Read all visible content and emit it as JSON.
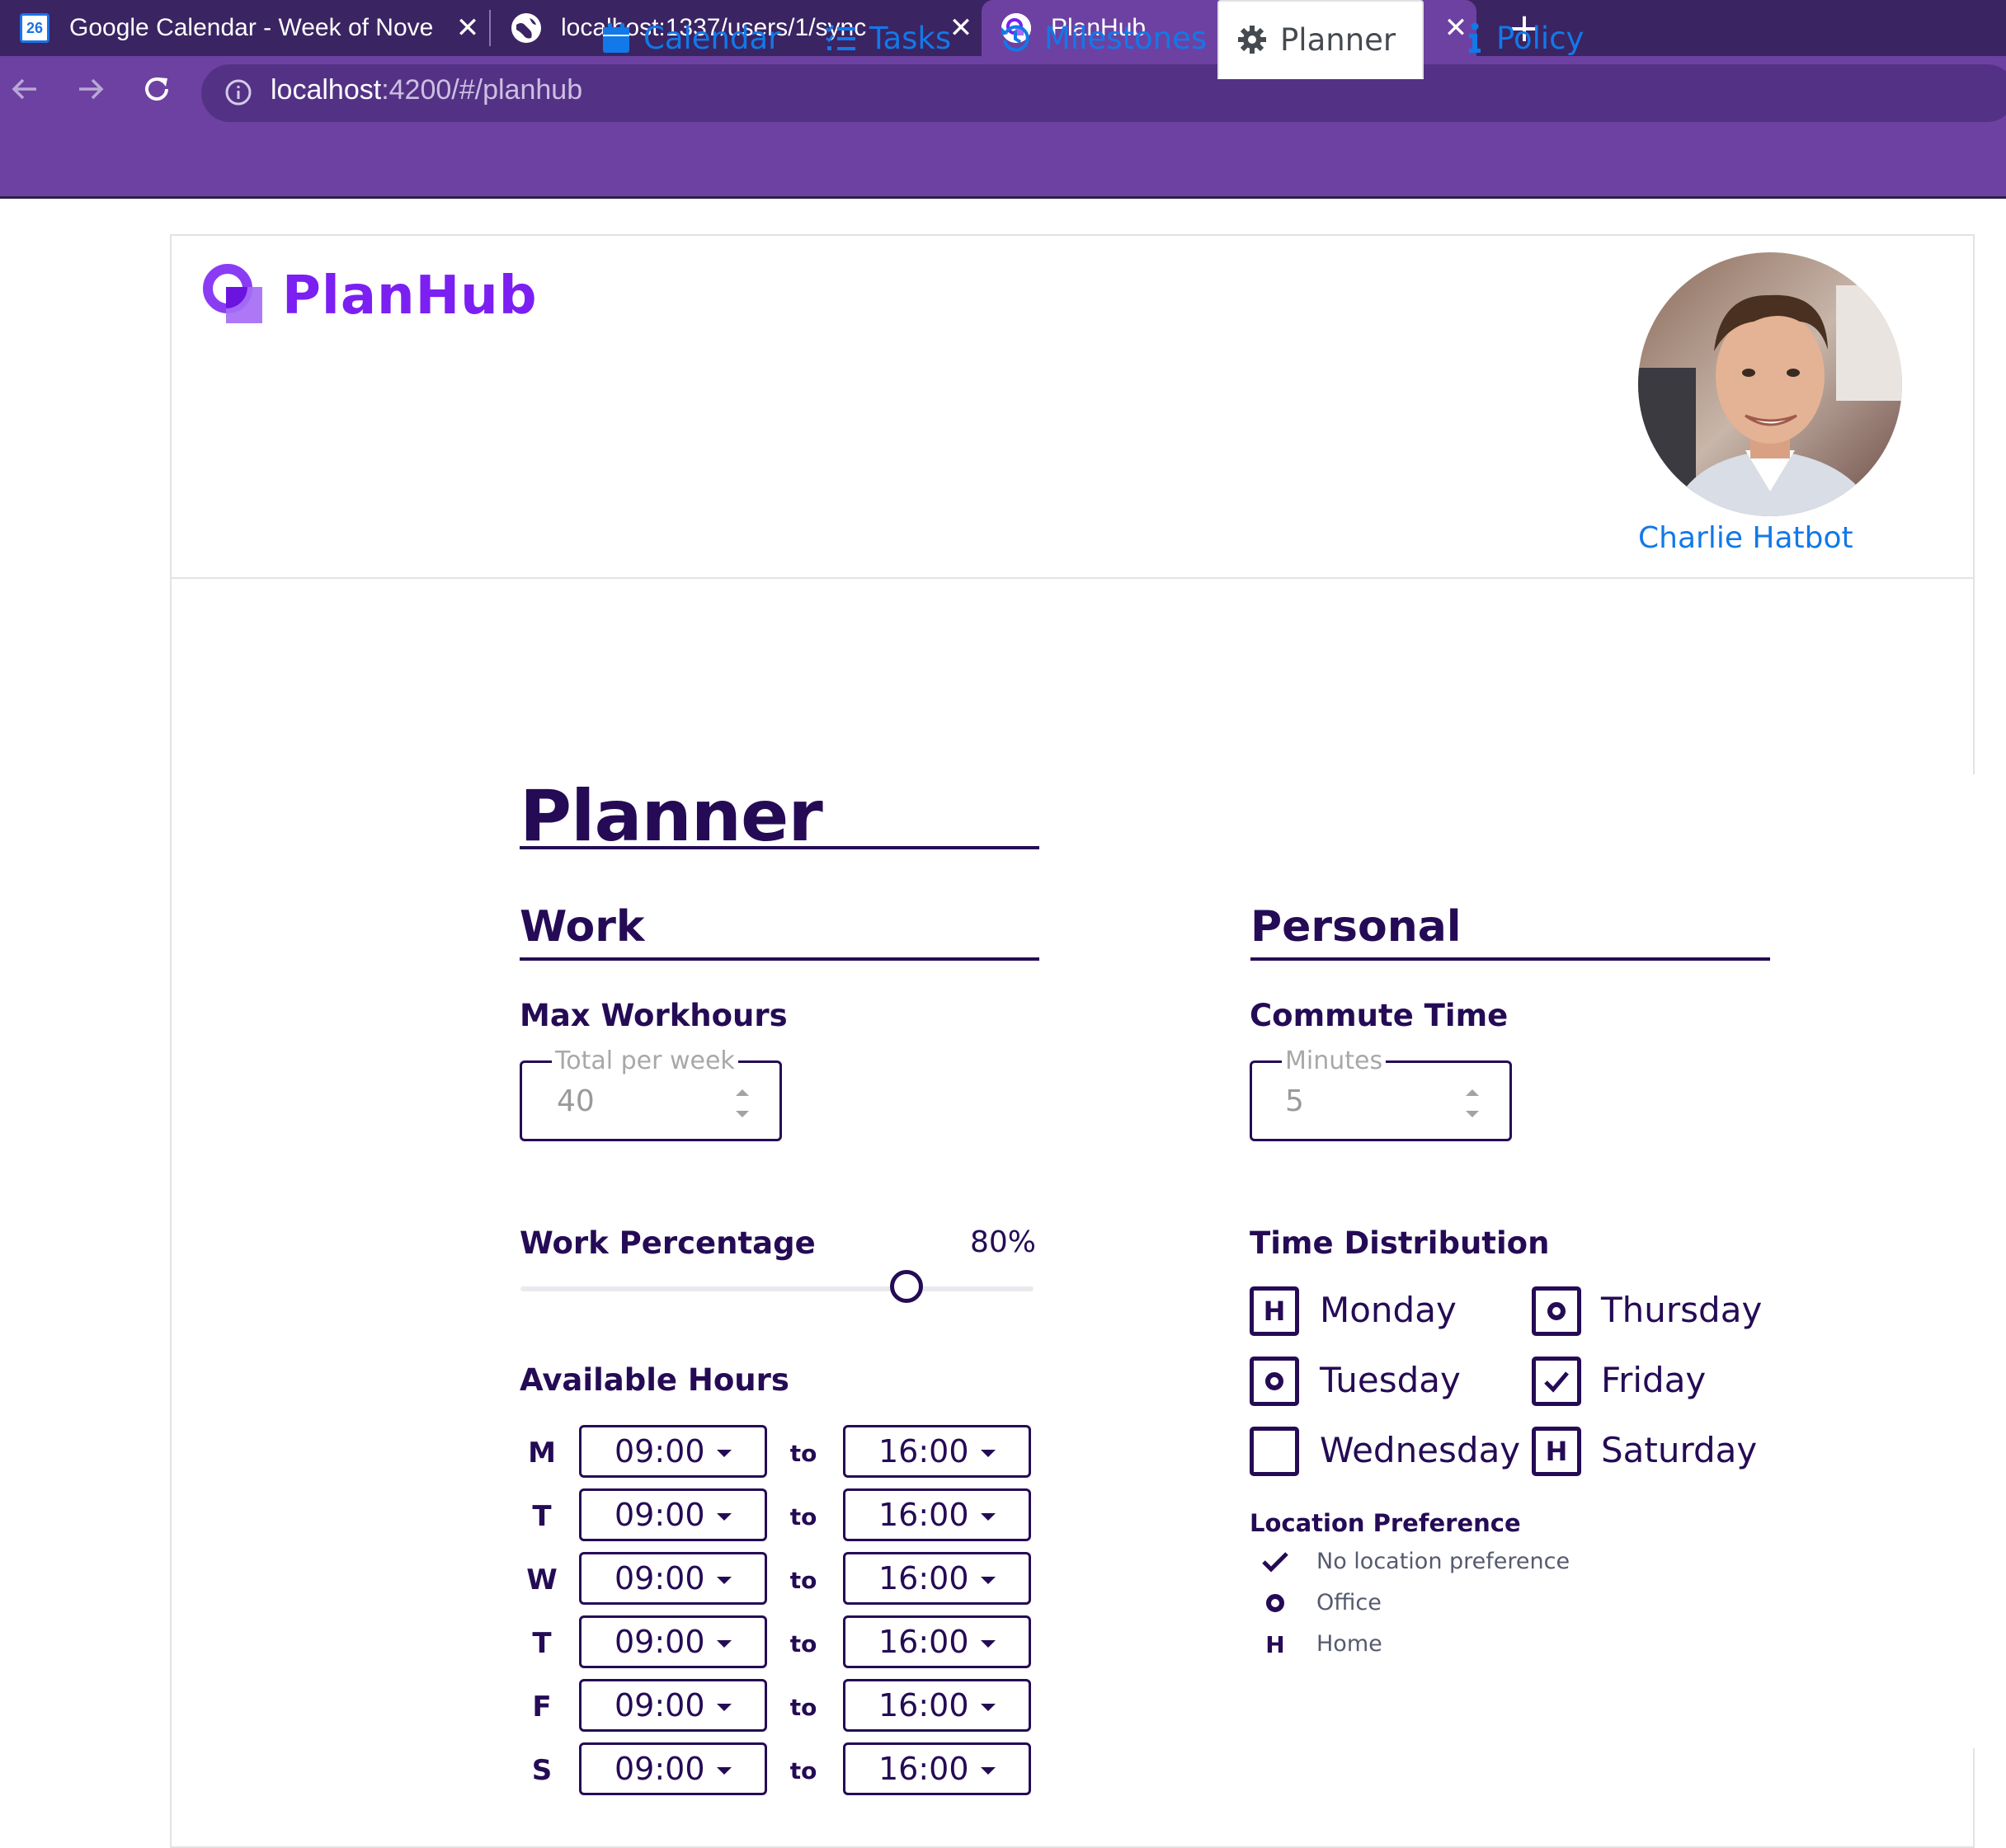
{
  "browser": {
    "tabs": [
      {
        "title": "Google Calendar - Week of Nove",
        "favicon": "google-calendar-icon",
        "favicon_text": "26",
        "active": false
      },
      {
        "title": "localhost:1337/users/1/sync",
        "favicon": "globe-icon",
        "active": false
      },
      {
        "title": "PlanHub",
        "favicon": "planhub-icon",
        "active": true
      }
    ],
    "new_tab_label": "+",
    "close_label": "✕",
    "url_host": "localhost",
    "url_rest": ":4200/#/planhub",
    "colors": {
      "frame": "#3a2462",
      "toolbar": "#6d41a1",
      "omnibox": "#533285"
    }
  },
  "app": {
    "logo_text": "PlanHub",
    "nav": [
      {
        "label": "Calendar",
        "icon": "calendar-icon",
        "active": false
      },
      {
        "label": "Tasks",
        "icon": "tasks-list-icon",
        "active": false
      },
      {
        "label": "Milestones",
        "icon": "history-icon",
        "active": false
      },
      {
        "label": "Planner",
        "icon": "gear-icon",
        "active": true
      },
      {
        "label": "Policy",
        "icon": "info-icon",
        "active": false
      }
    ],
    "user": {
      "name": "Charlie Hatbot"
    },
    "colors": {
      "brand": "#7b1ff2",
      "link": "#1279e8",
      "ink": "#250b55"
    }
  },
  "planner": {
    "title": "Planner",
    "work": {
      "title": "Work",
      "max_workhours": {
        "label": "Max Workhours",
        "legend": "Total per week",
        "value": "40"
      },
      "work_percentage": {
        "label": "Work Percentage",
        "value_text": "80%",
        "value": 0.8
      },
      "available_hours": {
        "label": "Available Hours",
        "to_label": "to",
        "rows": [
          {
            "day": "M",
            "from": "09:00",
            "to": "16:00"
          },
          {
            "day": "T",
            "from": "09:00",
            "to": "16:00"
          },
          {
            "day": "W",
            "from": "09:00",
            "to": "16:00"
          },
          {
            "day": "T",
            "from": "09:00",
            "to": "16:00"
          },
          {
            "day": "F",
            "from": "09:00",
            "to": "16:00"
          },
          {
            "day": "S",
            "from": "09:00",
            "to": "16:00"
          }
        ]
      }
    },
    "personal": {
      "title": "Personal",
      "commute_time": {
        "label": "Commute Time",
        "legend": "Minutes",
        "value": "5"
      },
      "time_distribution": {
        "label": "Time Distribution",
        "days": [
          {
            "day": "Monday",
            "mark": "H"
          },
          {
            "day": "Tuesday",
            "mark": "O"
          },
          {
            "day": "Wednesday",
            "mark": ""
          },
          {
            "day": "Thursday",
            "mark": "O"
          },
          {
            "day": "Friday",
            "mark": "check"
          },
          {
            "day": "Saturday",
            "mark": "H"
          }
        ]
      },
      "location_preference": {
        "label": "Location Preference",
        "items": [
          {
            "icon": "check-icon",
            "text": "No location preference"
          },
          {
            "icon": "office-circle-icon",
            "text": "Office"
          },
          {
            "icon": "home-h-icon",
            "symbol": "H",
            "text": "Home"
          }
        ]
      }
    }
  }
}
